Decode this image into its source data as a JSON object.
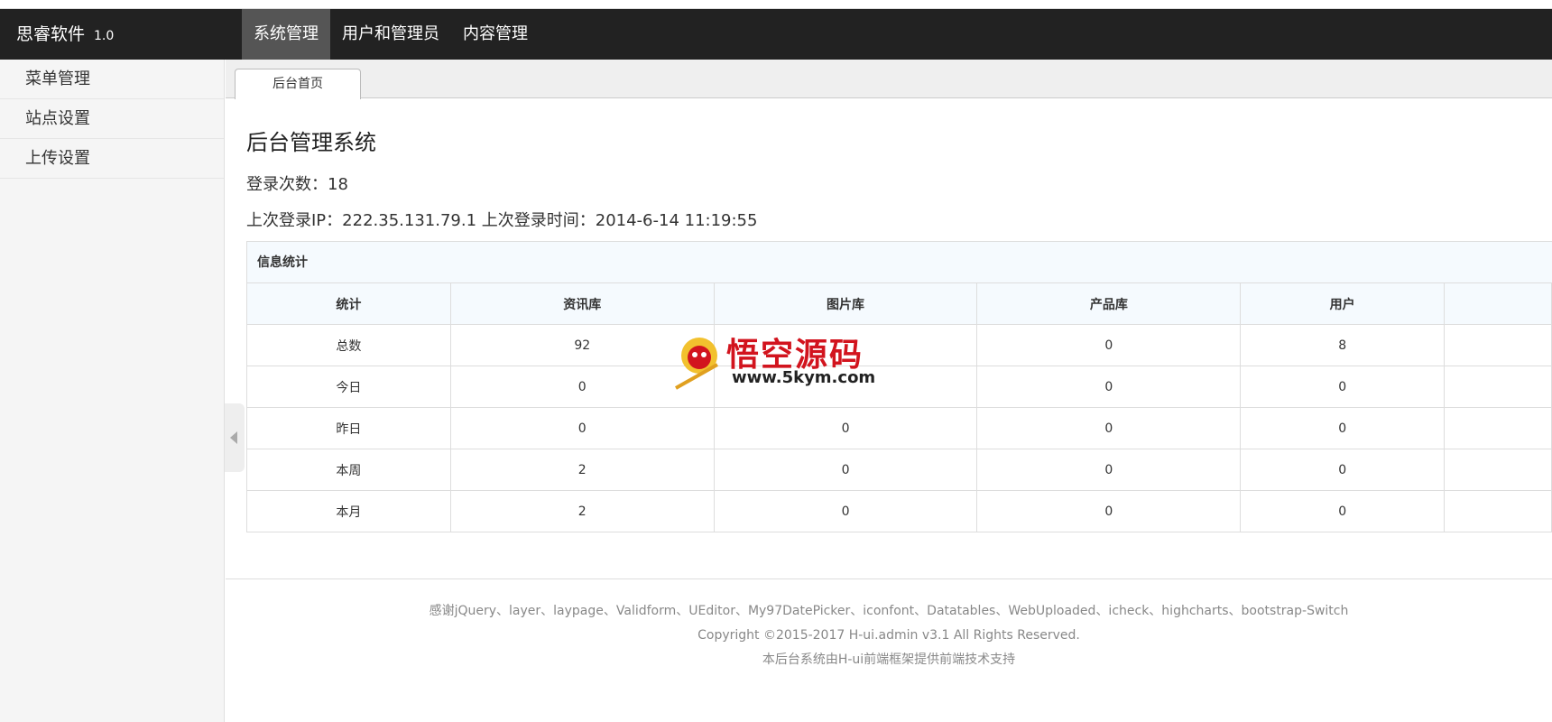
{
  "navbar": {
    "brand": "思睿软件",
    "version": "1.0",
    "items": [
      {
        "label": "系统管理"
      },
      {
        "label": "用户和管理员"
      },
      {
        "label": "内容管理"
      }
    ]
  },
  "sidebar": {
    "items": [
      {
        "label": "菜单管理"
      },
      {
        "label": "站点设置"
      },
      {
        "label": "上传设置"
      }
    ]
  },
  "tabs": [
    {
      "label": "后台首页"
    }
  ],
  "main": {
    "title": "后台管理系统",
    "login_count": "登录次数：18",
    "last_login": "上次登录IP：222.35.131.79.1 上次登录时间：2014-6-14 11:19:55"
  },
  "stats": {
    "caption": "信息统计",
    "headers": [
      "统计",
      "资讯库",
      "图片库",
      "产品库",
      "用户",
      ""
    ],
    "rows": [
      [
        "总数",
        "92",
        "",
        "0",
        "8",
        ""
      ],
      [
        "今日",
        "0",
        "",
        "0",
        "0",
        ""
      ],
      [
        "昨日",
        "0",
        "0",
        "0",
        "0",
        ""
      ],
      [
        "本周",
        "2",
        "0",
        "0",
        "0",
        ""
      ],
      [
        "本月",
        "2",
        "0",
        "0",
        "0",
        ""
      ]
    ]
  },
  "footer": {
    "thanks": "感谢jQuery、layer、laypage、Validform、UEditor、My97DatePicker、iconfont、Datatables、WebUploaded、icheck、highcharts、bootstrap-Switch",
    "copyright": "Copyright ©2015-2017 H-ui.admin v3.1 All Rights Reserved.",
    "support": "本后台系统由H-ui前端框架提供前端技术支持"
  },
  "watermark": {
    "title": "悟空源码",
    "url": "www.5kym.com"
  }
}
